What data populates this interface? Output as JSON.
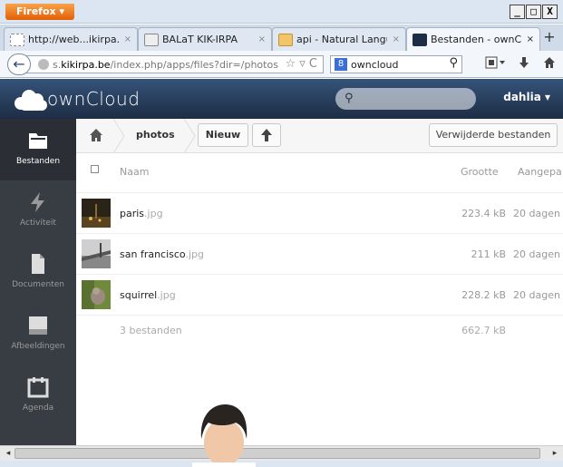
{
  "window": {
    "firefox_button": "Firefox ▾",
    "controls": [
      "_",
      "□",
      "X"
    ]
  },
  "tabs": [
    {
      "label": "http://web...ikirpa.be/",
      "close": "×"
    },
    {
      "label": "BALaT KIK-IRPA",
      "close": "×"
    },
    {
      "label": "api - Natural Langua...",
      "close": "×"
    },
    {
      "label": "Bestanden - ownClo...",
      "close": "×"
    }
  ],
  "newtab": "+",
  "navbar": {
    "back": "←",
    "url_prefix": "s.",
    "url_domain": "kikirpa.be",
    "url_path": "/index.php/apps/files?dir=/photos",
    "url_icons": "☆ ▿ C",
    "search_value": "owncloud",
    "search_engine_icon": "8",
    "search_icon": "⚲"
  },
  "owncloud": {
    "wordmark": "ownCloud",
    "search_icon": "⚲",
    "user": "dahlia ▾",
    "accent": "#1d2d44"
  },
  "sidebar": {
    "items": [
      {
        "label": "Bestanden",
        "icon": "folder-icon"
      },
      {
        "label": "Activiteit",
        "icon": "lightning-icon"
      },
      {
        "label": "Documenten",
        "icon": "document-icon"
      },
      {
        "label": "Afbeeldingen",
        "icon": "image-icon"
      },
      {
        "label": "Agenda",
        "icon": "calendar-icon"
      }
    ]
  },
  "controls": {
    "breadcrumb_current": "photos",
    "new_button": "Nieuw",
    "deleted_button": "Verwijderde bestanden"
  },
  "filelist": {
    "headers": {
      "name": "Naam",
      "size": "Grootte",
      "modified": "Aangepa"
    },
    "rows": [
      {
        "name": "paris",
        "ext": ".jpg",
        "size": "223.4 kB",
        "modified": "20 dagen"
      },
      {
        "name": "san francisco",
        "ext": ".jpg",
        "size": "211 kB",
        "modified": "20 dagen"
      },
      {
        "name": "squirrel",
        "ext": ".jpg",
        "size": "228.2 kB",
        "modified": "20 dagen"
      }
    ],
    "summary": {
      "count": "3 bestanden",
      "size": "662.7 kB"
    }
  },
  "scrollbar": {
    "left": "◂",
    "right": "▸"
  }
}
